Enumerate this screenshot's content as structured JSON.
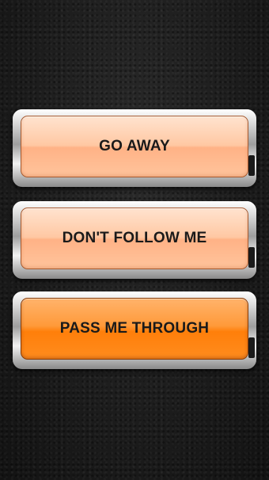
{
  "buttons": [
    {
      "label": "GO AWAY",
      "state": "normal"
    },
    {
      "label": "DON'T FOLLOW ME",
      "state": "normal"
    },
    {
      "label": "PASS ME THROUGH",
      "state": "highlighted"
    }
  ],
  "colors": {
    "background": "#1d1d1d",
    "button_normal": "#ffc8a3",
    "button_highlighted": "#ff8c1e",
    "frame": "#c8c8c8",
    "label_text": "#1a1a1a"
  }
}
